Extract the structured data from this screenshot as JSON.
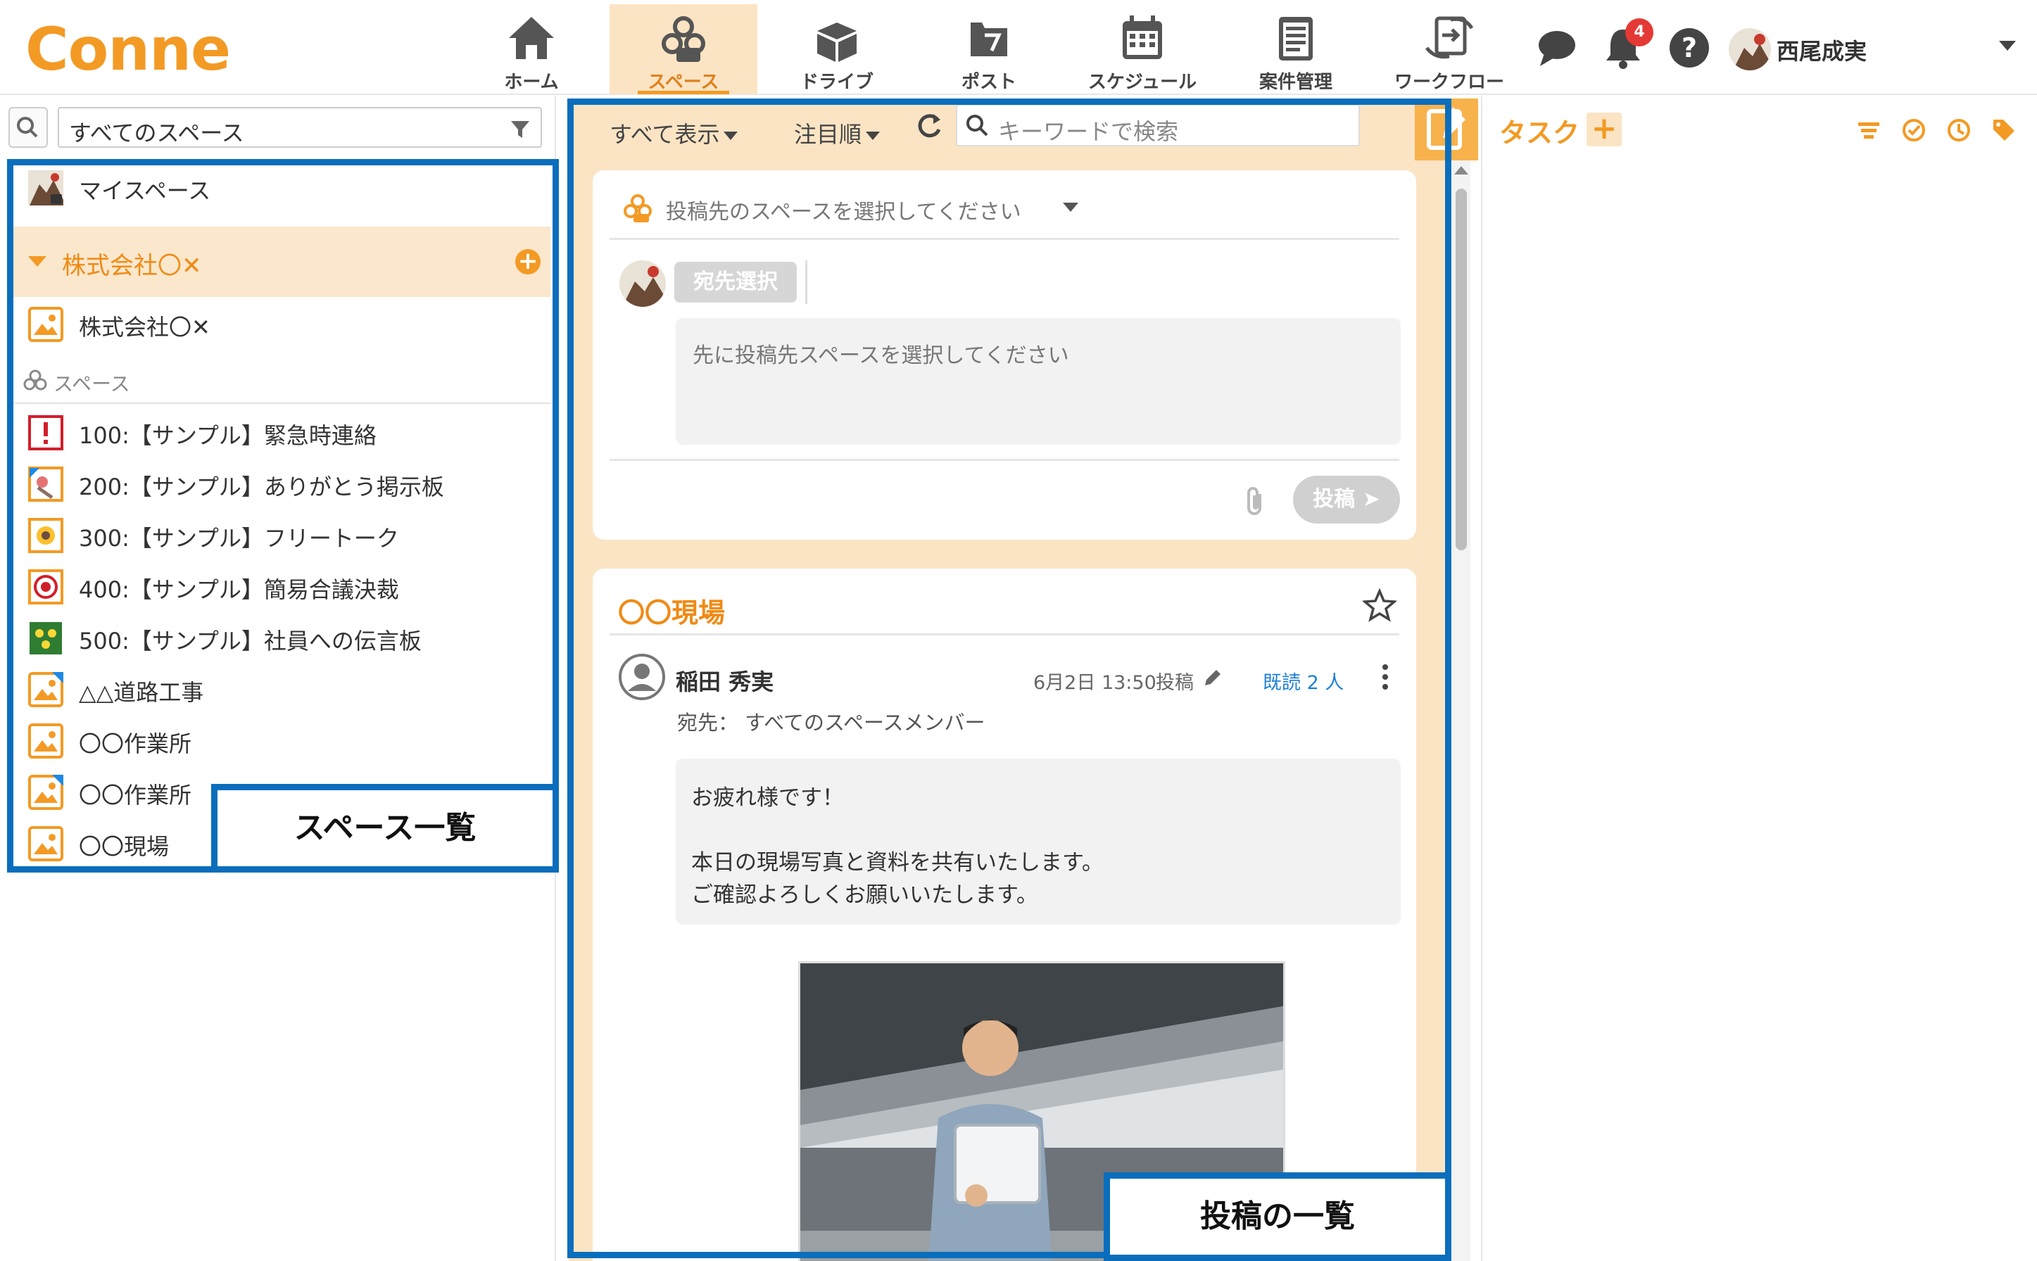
{
  "app": {
    "logo": "Conne"
  },
  "header": {
    "nav": [
      {
        "label": "ホーム",
        "icon": "home-icon"
      },
      {
        "label": "スペース",
        "icon": "space-icon",
        "active": true
      },
      {
        "label": "ドライブ",
        "icon": "drive-icon"
      },
      {
        "label": "ポスト",
        "icon": "post-icon"
      },
      {
        "label": "スケジュール",
        "icon": "calendar-icon"
      },
      {
        "label": "案件管理",
        "icon": "project-icon"
      },
      {
        "label": "ワークフロー",
        "icon": "workflow-icon"
      }
    ],
    "notification_count": "4",
    "user_name": "西尾成実"
  },
  "sidebar": {
    "filter_value": "すべてのスペース",
    "my_space": "マイスペース",
    "company": "株式会社〇✕",
    "company_item": "株式会社〇✕",
    "section_label": "スペース",
    "spaces": [
      {
        "label": "100:【サンプル】緊急時連絡",
        "icon": "alert-icon"
      },
      {
        "label": "200:【サンプル】ありがとう掲示板",
        "icon": "thanks-board-icon"
      },
      {
        "label": "300:【サンプル】フリートーク",
        "icon": "sunflower-icon"
      },
      {
        "label": "400:【サンプル】簡易合議決裁",
        "icon": "approval-icon"
      },
      {
        "label": "500:【サンプル】社員への伝言板",
        "icon": "message-board-icon"
      },
      {
        "label": "△△道路工事",
        "icon": "image-icon"
      },
      {
        "label": "〇〇作業所",
        "icon": "image-icon"
      },
      {
        "label": "〇〇作業所",
        "icon": "image-icon"
      },
      {
        "label": "〇〇現場",
        "icon": "image-icon"
      }
    ]
  },
  "annotations": {
    "space_list": "スペース一覧",
    "post_list": "投稿の一覧"
  },
  "timeline": {
    "show_filter": "すべて表示",
    "sort": "注目順",
    "search_placeholder": "キーワードで検索",
    "composer": {
      "target_placeholder": "投稿先のスペースを選択してください",
      "recipient_button": "宛先選択",
      "text_placeholder": "先に投稿先スペースを選択してください",
      "post_button": "投稿"
    },
    "post": {
      "space": "〇〇現場",
      "author": "稲田 秀実",
      "date": "6月2日 13:50",
      "action": "投稿",
      "read": "既読 2 人",
      "to": "宛先： すべてのスペースメンバー",
      "body": [
        "お疲れ様です！",
        "",
        "本日の現場写真と資料を共有いたします。",
        "ご確認よろしくお願いいたします。"
      ]
    }
  },
  "tasks": {
    "title": "タスク"
  },
  "colors": {
    "accent": "#f39a24",
    "accent_light": "#fbe4c4",
    "annotation": "#0a6ebd",
    "link": "#1e7fd8"
  }
}
